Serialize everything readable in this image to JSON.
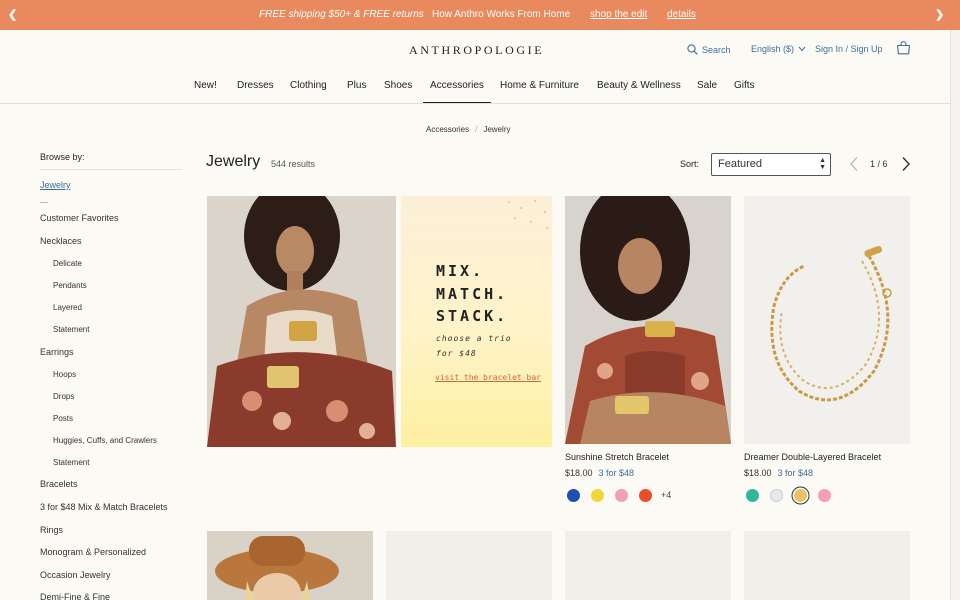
{
  "promo_bar": {
    "message_1": "FREE shipping $50+ & FREE returns",
    "message_2": "How Anthro Works From Home",
    "link_1": "shop the edit",
    "link_2": "details",
    "bg_color": "#e88a5e"
  },
  "header": {
    "logo": "ANTHROPOLOGIE",
    "search_label": "Search",
    "language_label": "English ($)",
    "sign_in_label": "Sign In / Sign Up"
  },
  "nav": {
    "items": [
      "New!",
      "Dresses",
      "Clothing",
      "Plus",
      "Shoes",
      "Accessories",
      "Home & Furniture",
      "Beauty & Wellness",
      "Sale",
      "Gifts"
    ],
    "active": "Accessories"
  },
  "breadcrumb": {
    "parent": "Accessories",
    "separator": "/",
    "current": "Jewelry"
  },
  "sidebar": {
    "heading": "Browse by:",
    "current": "Jewelry",
    "links": [
      "Customer Favorites",
      "Necklaces",
      "Delicate",
      "Pendants",
      "Layered",
      "Statement",
      "Earrings",
      "Hoops",
      "Drops",
      "Posts",
      "Huggies, Cuffs, and Crawlers",
      "Statement",
      "Bracelets",
      "3 for $48 Mix & Match Bracelets",
      "Rings",
      "Monogram & Personalized",
      "Occasion Jewelry",
      "Demi-Fine & Fine"
    ]
  },
  "listing": {
    "title": "Jewelry",
    "count": "544 results",
    "sort_label": "Sort:",
    "sort_value": "Featured",
    "page": "1 / 6"
  },
  "promo_tile": {
    "headline": [
      "MIX.",
      "MATCH.",
      "STACK."
    ],
    "subline": [
      "choose a trio",
      "for $48"
    ],
    "cta": "visit the bracelet bar"
  },
  "products": [
    {
      "name": "Sunshine Stretch Bracelet",
      "price": "$18.00",
      "deal": "3 for $48",
      "swatches": [
        "#1f4fb5",
        "#f0d638",
        "#f4a0b4",
        "#e8502a"
      ],
      "selected_swatch": -1,
      "more": "+4"
    },
    {
      "name": "Dreamer Double-Layered Bracelet",
      "price": "$18.00",
      "deal": "3 for $48",
      "swatches": [
        "#2db89c",
        "#e8e8ea",
        "#e8c264",
        "#f4a0b0"
      ],
      "selected_swatch": 2,
      "more": ""
    }
  ],
  "colors": {
    "link_blue": "#3f6e9a",
    "cta_orange": "#d0643c"
  }
}
